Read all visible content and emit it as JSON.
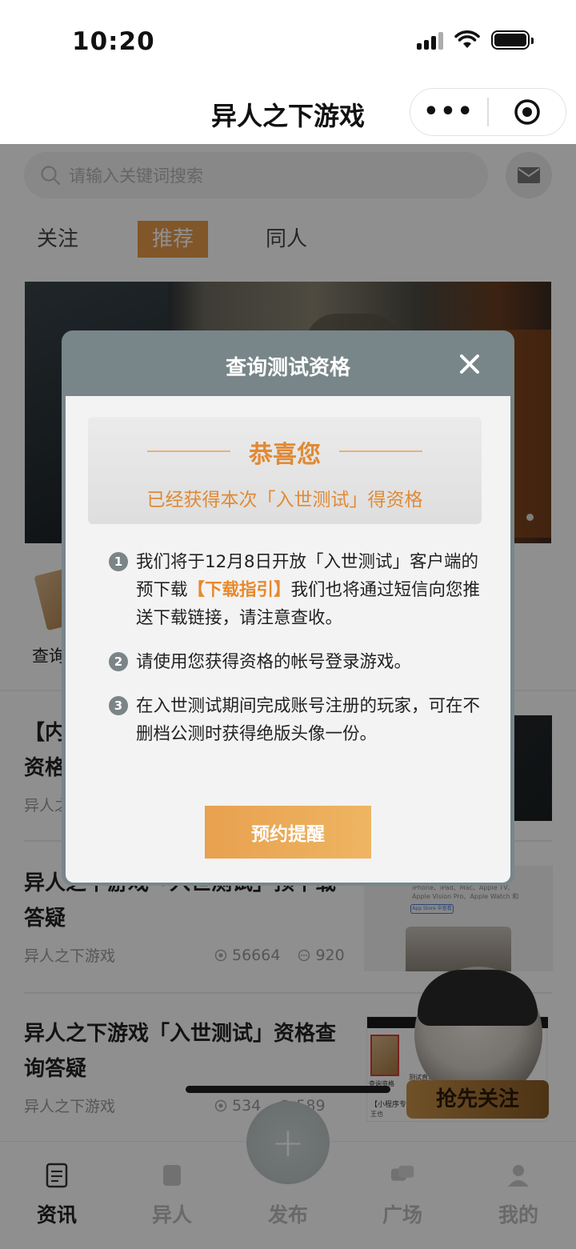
{
  "status": {
    "time": "10:20"
  },
  "nav": {
    "title": "异人之下游戏",
    "more": "•••"
  },
  "search": {
    "placeholder": "请输入关键词搜索"
  },
  "tabs": [
    "关注",
    "推荐",
    "同人"
  ],
  "quick": {
    "label": "查询"
  },
  "articles": [
    {
      "title": "【内",
      "title2": "资格",
      "source": "异人之"
    },
    {
      "title": "异人之下游戏「入世测试」预下载答疑",
      "source": "异人之下游戏",
      "views": "56664",
      "comments": "920"
    },
    {
      "title": "异人之下游戏「入世测试」资格查询答疑",
      "source": "异人之下游戏",
      "views": "534",
      "comments": "589"
    }
  ],
  "thumb2": {
    "line1": "iPhone、iPad、Mac、Apple TV、",
    "line2": "Apple Vision Pro、Apple Watch 和",
    "pill": "App Store 中查看"
  },
  "thumb3": {
    "t1": "查询资格",
    "t2": "测试直通",
    "t3": "【小程序专属",
    "t4": "王也"
  },
  "promo": {
    "label": "抢先关注"
  },
  "tabbar": [
    "资讯",
    "异人",
    "发布",
    "广场",
    "我的"
  ],
  "modal": {
    "title": "查询测试资格",
    "congrats": "恭喜您",
    "subtitle": "已经获得本次「入世测试」得资格",
    "step1_a": "我们将于12月8日开放「入世测试」客户端的预下载",
    "step1_link": "【下载指引】",
    "step1_b": "我们也将通过短信向您推送下载链接，请注意查收。",
    "step2": "请使用您获得资格的帐号登录游戏。",
    "step3": "在入世测试期间完成账号注册的玩家，可在不删档公测时获得绝版头像一份。",
    "button": "预约提醒"
  },
  "colors": {
    "accent": "#e8892a",
    "modal_header": "#78868a",
    "tab_active": "#e69a4a"
  }
}
